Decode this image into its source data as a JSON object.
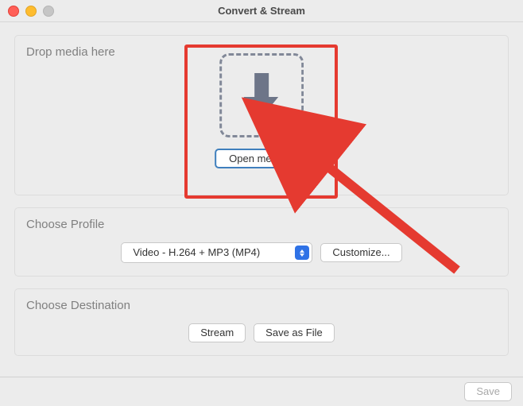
{
  "window": {
    "title": "Convert & Stream"
  },
  "drop": {
    "title": "Drop media here",
    "open_media_label": "Open media..."
  },
  "profile": {
    "title": "Choose Profile",
    "selected": "Video - H.264 + MP3 (MP4)",
    "customize_label": "Customize..."
  },
  "destination": {
    "title": "Choose Destination",
    "stream_label": "Stream",
    "save_label": "Save as File"
  },
  "footer": {
    "save_label": "Save"
  }
}
